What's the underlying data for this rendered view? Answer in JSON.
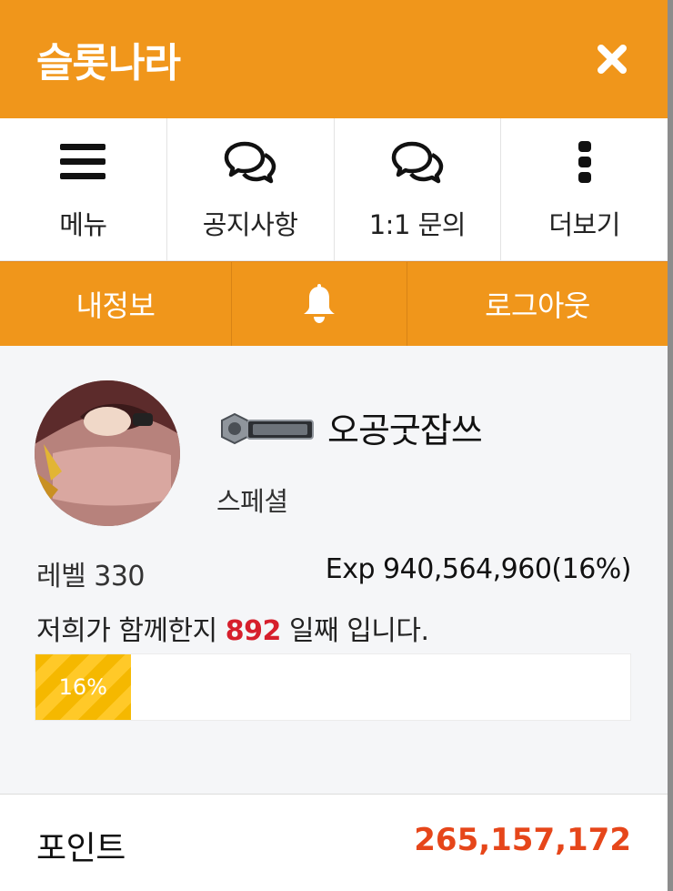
{
  "header": {
    "title": "슬롯나라",
    "close_icon": "close-icon"
  },
  "nav": {
    "items": [
      {
        "label": "메뉴",
        "icon": "hamburger-icon"
      },
      {
        "label": "공지사항",
        "icon": "chat-bubbles-icon"
      },
      {
        "label": "1:1 문의",
        "icon": "chat-bubbles-icon"
      },
      {
        "label": "더보기",
        "icon": "vertical-dots-icon"
      }
    ]
  },
  "subbar": {
    "my_info": "내정보",
    "bell_icon": "bell-icon",
    "logout": "로그아웃"
  },
  "profile": {
    "nickname": "오공굿잡쓰",
    "grade": "스페셜",
    "level_label": "레벨 330",
    "exp_label": "Exp 940,564,960(16%)",
    "days_prefix": "저희가 함께한지",
    "days_count": "892",
    "days_suffix": "일째 입니다.",
    "progress_text": "16%",
    "progress_value": 0.16
  },
  "points": {
    "label": "포인트",
    "value": "265,157,172"
  },
  "colors": {
    "brand_orange": "#f0961b",
    "points_red": "#e6461a",
    "days_red": "#d61f2c",
    "progress_yellow": "#f5b800"
  }
}
